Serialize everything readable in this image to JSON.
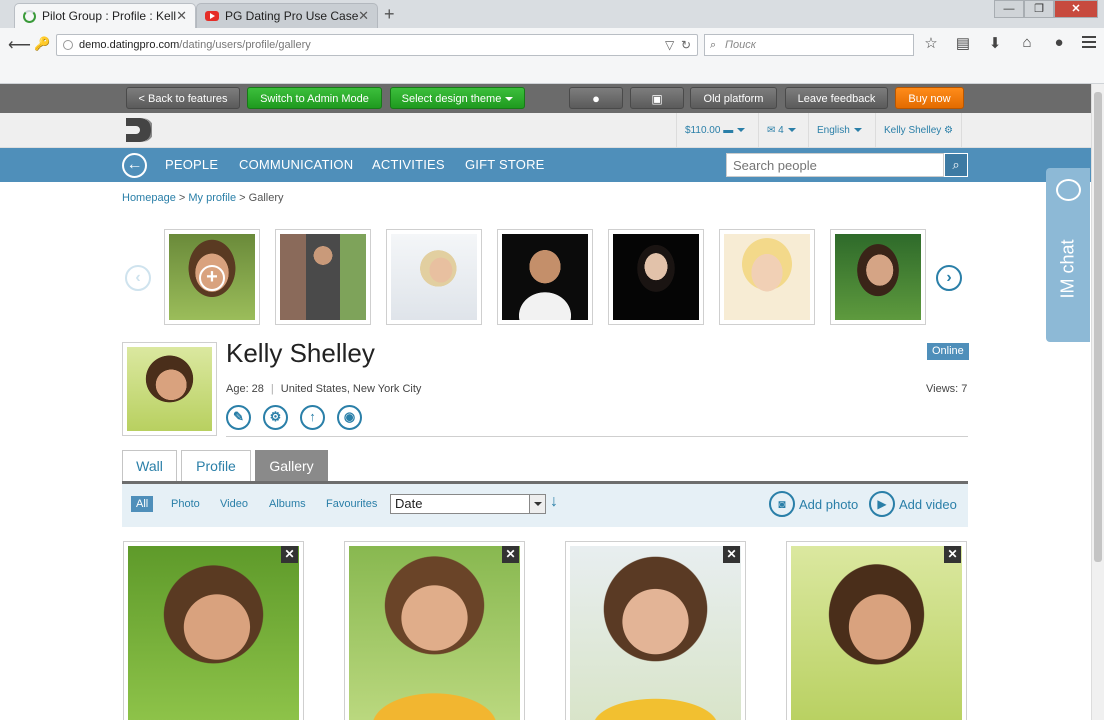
{
  "browser": {
    "tabs": [
      {
        "title": "Pilot Group : Profile : Kelly ...",
        "active": true
      },
      {
        "title": "PG Dating Pro Use Case - Y...",
        "active": false
      }
    ],
    "new_tab": "+",
    "close_glyph": "✕",
    "url_host": "demo.datingpro.com",
    "url_path": "/dating/users/profile/gallery",
    "search_placeholder": "Поиск",
    "window_buttons": {
      "minimize": "—",
      "maximize": "❐",
      "close": "✕"
    },
    "icons": [
      "bookmark-star-icon",
      "reading-list-icon",
      "download-icon",
      "home-icon",
      "chat-icon",
      "menu-icon"
    ]
  },
  "demobar": {
    "back": "< Back to features",
    "admin": "Switch to Admin Mode",
    "theme": "Select design theme",
    "old_platform": "Old platform",
    "feedback": "Leave feedback",
    "buy": "Buy now"
  },
  "header": {
    "balance": "$110.00",
    "messages": "4",
    "language": "English",
    "user": "Kelly Shelley"
  },
  "nav": {
    "items": [
      "PEOPLE",
      "COMMUNICATION",
      "ACTIVITIES",
      "GIFT STORE"
    ],
    "search_placeholder": "Search people"
  },
  "breadcrumb": {
    "home": "Homepage",
    "profile": "My profile",
    "current": "Gallery",
    "sep": ">"
  },
  "profile": {
    "name": "Kelly Shelley",
    "status": "Online",
    "age_label": "Age: 28",
    "location": "United States, New York City",
    "views": "Views: 7",
    "separator": "|"
  },
  "tabs": [
    "Wall",
    "Profile",
    "Gallery"
  ],
  "filters": {
    "items": [
      "All",
      "Photo",
      "Video",
      "Albums",
      "Favourites"
    ],
    "sort_value": "Date",
    "add_photo": "Add photo",
    "add_video": "Add video"
  },
  "im_chat": "IM chat",
  "colors": {
    "accent": "#4f8fba",
    "link": "#2a7fa8",
    "green_button": "#1f9a1f",
    "orange_button": "#e36b00",
    "demobar": "#6b6b6b"
  }
}
